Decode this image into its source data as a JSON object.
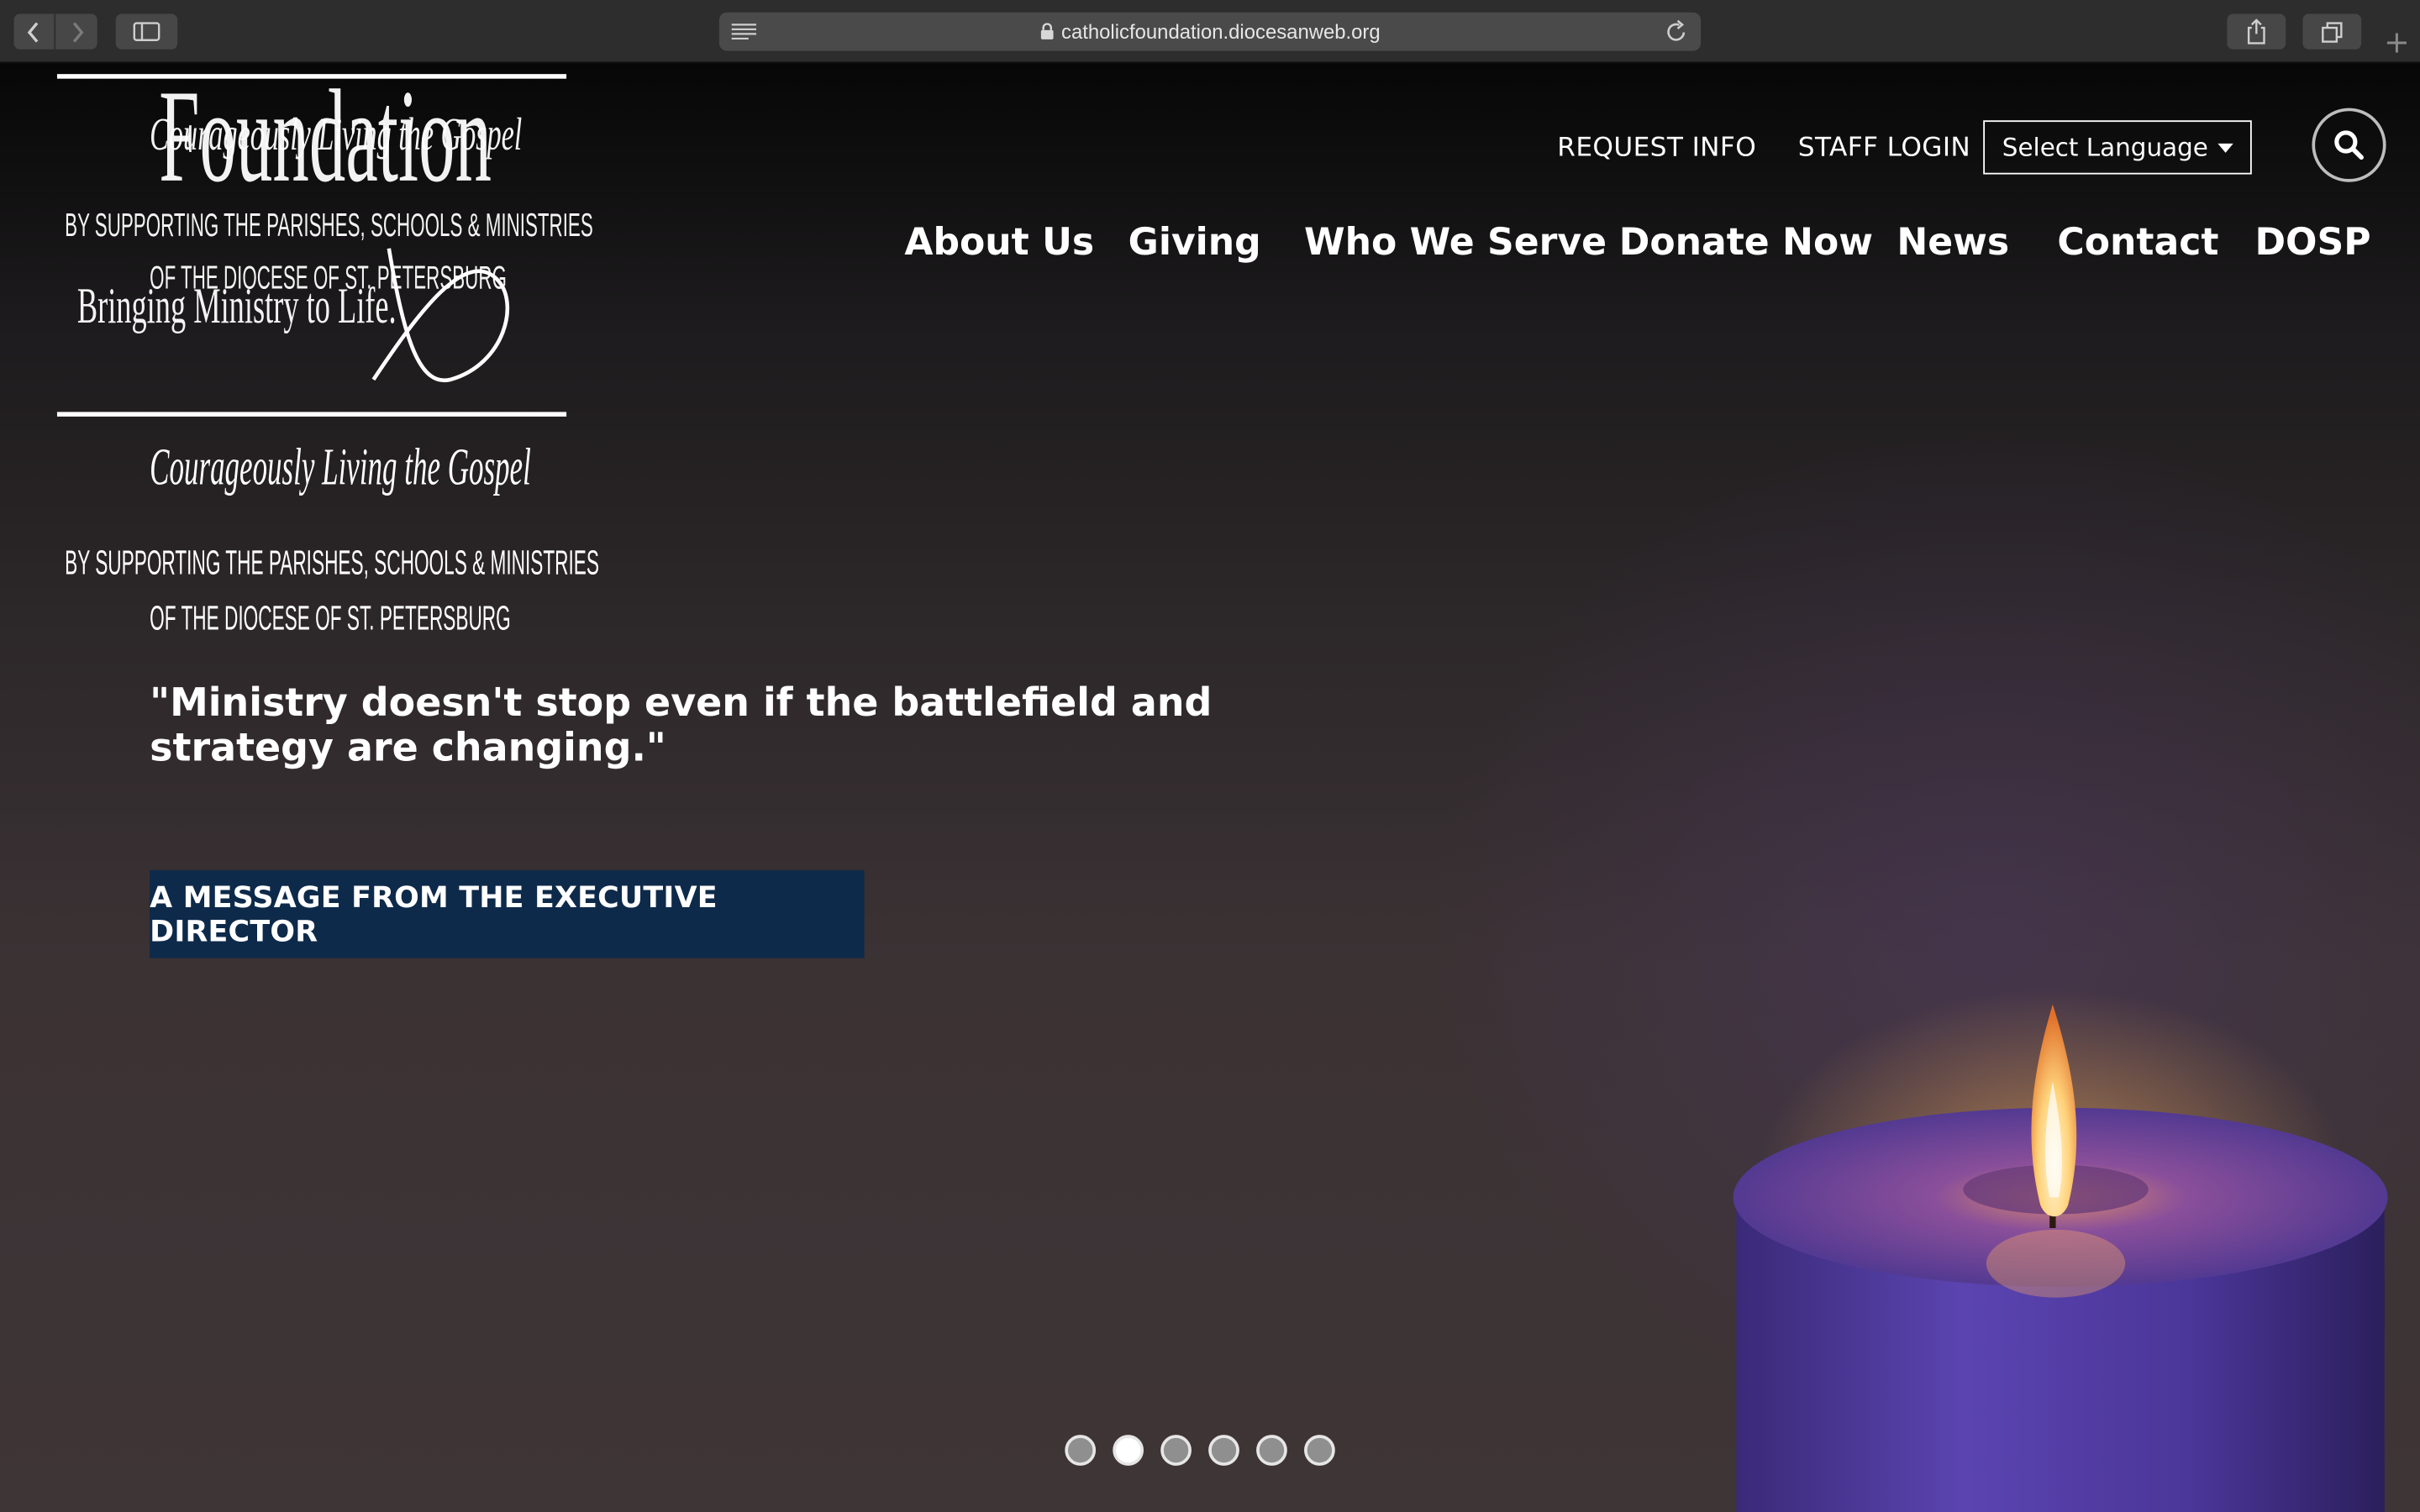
{
  "browser": {
    "url": "catholicfoundation.diocesanweb.org",
    "new_tab_symbol": "+"
  },
  "logo": {
    "wordmark": "Foundation",
    "tagline_small": "Bringing Ministry to Life.",
    "motto": "Courageously Living the Gospel",
    "line1": "BY SUPPORTING THE PARISHES, SCHOOLS & MINISTRIES",
    "line2": "OF THE DIOCESE OF ST. PETERSBURG"
  },
  "utility_nav": {
    "request_info": "REQUEST INFO",
    "staff_login": "STAFF LOGIN",
    "language_select": "Select Language"
  },
  "main_nav": [
    {
      "label": "About Us"
    },
    {
      "label": "Giving"
    },
    {
      "label": "Who We Serve"
    },
    {
      "label": "Donate Now"
    },
    {
      "label": "News"
    },
    {
      "label": "Contact"
    },
    {
      "label": "DOSP"
    }
  ],
  "hero": {
    "quote": "\"Ministry doesn't stop even if the battlefield and strategy are changing.\"",
    "cta_label": "A MESSAGE FROM THE EXECUTIVE DIRECTOR"
  },
  "slider": {
    "total_slides": 6,
    "active_slide": 2
  },
  "colors": {
    "cta_background": "#0e2a4a",
    "candle_purple": "#5a3a9a",
    "flame": "#ffd27a"
  }
}
